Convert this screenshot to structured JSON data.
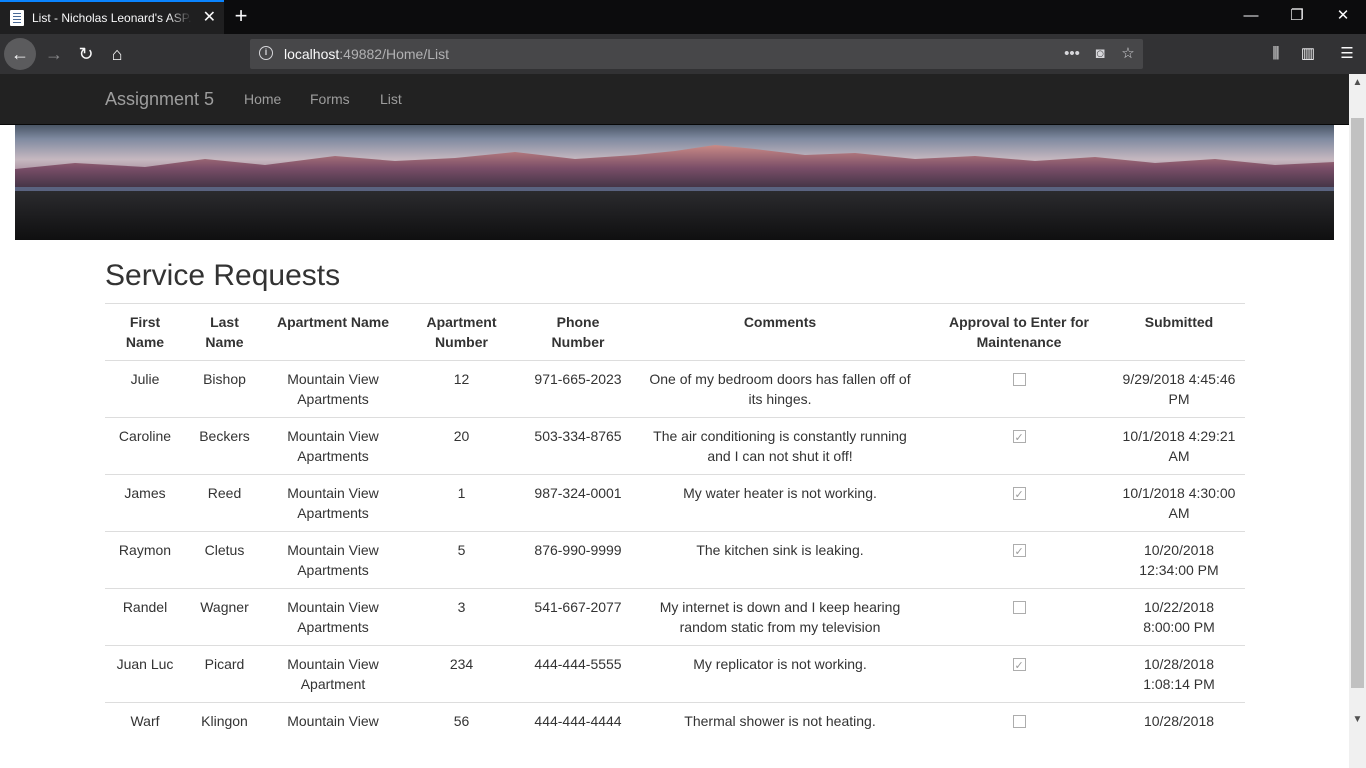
{
  "browser": {
    "tab_title": "List - Nicholas Leonard's ASP.NET",
    "url_host": "localhost",
    "url_path": ":49882/Home/List"
  },
  "site": {
    "brand": "Assignment 5",
    "nav": [
      "Home",
      "Forms",
      "List"
    ]
  },
  "page": {
    "title": "Service Requests"
  },
  "table": {
    "headers": [
      "First Name",
      "Last Name",
      "Apartment Name",
      "Apartment Number",
      "Phone Number",
      "Comments",
      "Approval to Enter for Maintenance",
      "Submitted"
    ],
    "rows": [
      {
        "first": "Julie",
        "last": "Bishop",
        "apt_name": "Mountain View Apartments",
        "apt_num": "12",
        "phone": "971-665-2023",
        "comments": "One of my bedroom doors has fallen off of its hinges.",
        "approved": false,
        "submitted": "9/29/2018 4:45:46 PM"
      },
      {
        "first": "Caroline",
        "last": "Beckers",
        "apt_name": "Mountain View Apartments",
        "apt_num": "20",
        "phone": "503-334-8765",
        "comments": "The air conditioning is constantly running and I can not shut it off!",
        "approved": true,
        "submitted": "10/1/2018 4:29:21 AM"
      },
      {
        "first": "James",
        "last": "Reed",
        "apt_name": "Mountain View Apartments",
        "apt_num": "1",
        "phone": "987-324-0001",
        "comments": "My water heater is not working.",
        "approved": true,
        "submitted": "10/1/2018 4:30:00 AM"
      },
      {
        "first": "Raymon",
        "last": "Cletus",
        "apt_name": "Mountain View Apartments",
        "apt_num": "5",
        "phone": "876-990-9999",
        "comments": "The kitchen sink is leaking.",
        "approved": true,
        "submitted": "10/20/2018 12:34:00 PM"
      },
      {
        "first": "Randel",
        "last": "Wagner",
        "apt_name": "Mountain View Apartments",
        "apt_num": "3",
        "phone": "541-667-2077",
        "comments": "My internet is down and I keep hearing random static from my television",
        "approved": false,
        "submitted": "10/22/2018 8:00:00 PM"
      },
      {
        "first": "Juan Luc",
        "last": "Picard",
        "apt_name": "Mountain View Apartment",
        "apt_num": "234",
        "phone": "444-444-5555",
        "comments": "My replicator is not working.",
        "approved": true,
        "submitted": "10/28/2018 1:08:14 PM"
      },
      {
        "first": "Warf",
        "last": "Klingon",
        "apt_name": "Mountain View",
        "apt_num": "56",
        "phone": "444-444-4444",
        "comments": "Thermal shower is not heating.",
        "approved": false,
        "submitted": "10/28/2018"
      }
    ]
  },
  "icons": {
    "close": "close-icon",
    "new_tab": "plus-icon",
    "back": "arrow-left-icon",
    "forward": "arrow-right-icon",
    "reload": "reload-icon",
    "home": "home-icon",
    "info": "info-icon",
    "more": "ellipsis-icon",
    "pocket": "pocket-icon",
    "bookmark": "star-icon",
    "library": "library-icon",
    "sidebar": "sidebar-icon",
    "menu": "hamburger-icon"
  },
  "colors": {
    "accent_tab": "#0a84ff",
    "site_nav_bg": "#222222",
    "site_nav_text": "#9d9d9d"
  }
}
